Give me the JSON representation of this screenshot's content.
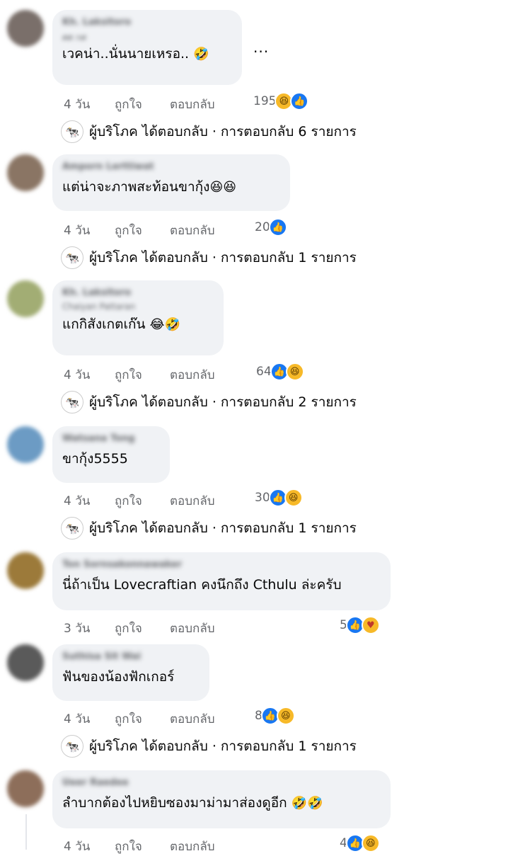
{
  "ellipsis": "...",
  "comments": [
    {
      "author": "Kh. Laksitoro",
      "sub": "ศศ กศ",
      "text": "เวคน่า..นั่นนายเหรอ..",
      "emoji": "🤣",
      "time": "4 วัน",
      "like": "ถูกใจ",
      "reply": "ตอบกลับ",
      "reaction_count": "195",
      "replies": {
        "page": "ผู้บริโภค",
        "text": "ได้ตอบกลับ · การตอบกลับ 6 รายการ"
      }
    },
    {
      "author": "Amporn Lerttiwat",
      "text": "แต่น่าจะภาพสะท้อนขากุ้ง",
      "emoji": "😆😆",
      "time": "4 วัน",
      "like": "ถูกใจ",
      "reply": "ตอบกลับ",
      "reaction_count": "20",
      "replies": {
        "page": "ผู้บริโภค",
        "text": "ได้ตอบกลับ · การตอบกลับ 1 รายการ"
      }
    },
    {
      "author": "Kh. Laksitoro",
      "sub": "Chaiyan Pattaran",
      "text": "แกกิสังเกตเก๊น",
      "emoji": "😂🤣",
      "time": "4 วัน",
      "like": "ถูกใจ",
      "reply": "ตอบกลับ",
      "reaction_count": "64",
      "replies": {
        "page": "ผู้บริโภค",
        "text": "ได้ตอบกลับ · การตอบกลับ 2 รายการ"
      }
    },
    {
      "author": "Watsana Tong",
      "text": "ขากุ้ง5555",
      "emoji": "",
      "time": "4 วัน",
      "like": "ถูกใจ",
      "reply": "ตอบกลับ",
      "reaction_count": "30",
      "replies": {
        "page": "ผู้บริโภค",
        "text": "ได้ตอบกลับ · การตอบกลับ 1 รายการ"
      }
    },
    {
      "author": "Ton Sornsakonnawaker",
      "text": "นี่ถ้าเป็น Lovecraftian คงนึกถึง Cthulu ล่ะครับ",
      "emoji": "",
      "time": "3 วัน",
      "like": "ถูกใจ",
      "reply": "ตอบกลับ",
      "reaction_count": "5"
    },
    {
      "author": "Suthisa Sit Wai",
      "text": "ฟันของน้องฟักเกอร์",
      "emoji": "",
      "time": "4 วัน",
      "like": "ถูกใจ",
      "reply": "ตอบกลับ",
      "reaction_count": "8",
      "replies": {
        "page": "ผู้บริโภค",
        "text": "ได้ตอบกลับ · การตอบกลับ 1 รายการ"
      }
    },
    {
      "author": "Ueer Raedee",
      "text": "ลำบากต้องไปหยิบซองมาม่ามาส่องดูอีก",
      "emoji": "🤣🤣",
      "time": "4 วัน",
      "like": "ถูกใจ",
      "reply": "ตอบกลับ",
      "reaction_count": "4"
    }
  ],
  "colors": {
    "like": "#1877f2",
    "haha": "#f7b928",
    "bubble": "#f0f2f5",
    "meta": "#65676b"
  }
}
